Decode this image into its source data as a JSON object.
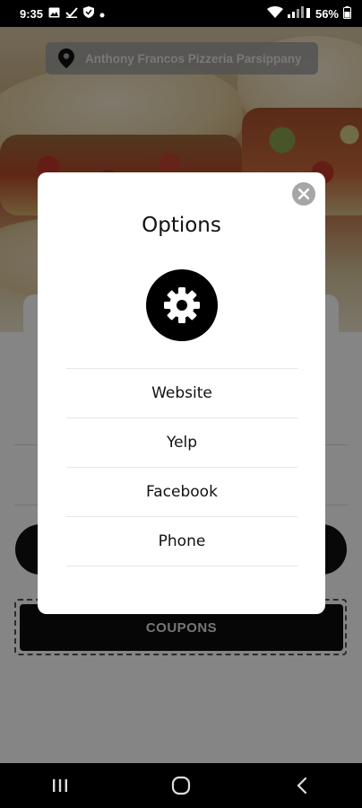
{
  "status_bar": {
    "time": "9:35",
    "battery": "56%",
    "icons_left": [
      "image-icon",
      "check-icon",
      "shield-icon",
      "dot-icon"
    ],
    "icons_right": [
      "wifi-icon",
      "signal-icon",
      "battery-icon"
    ]
  },
  "header": {
    "location": "Anthony Francos Pizzeria Parsippany"
  },
  "page": {
    "coupons_label": "COUPONS"
  },
  "modal": {
    "title": "Options",
    "icon": "gear-icon",
    "options": [
      {
        "label": "Website"
      },
      {
        "label": "Yelp"
      },
      {
        "label": "Facebook"
      },
      {
        "label": "Phone"
      }
    ]
  },
  "colors": {
    "scrim": "#000000",
    "modal_bg": "#ffffff",
    "close_button": "#a6a6a6",
    "gear_circle": "#000000"
  }
}
